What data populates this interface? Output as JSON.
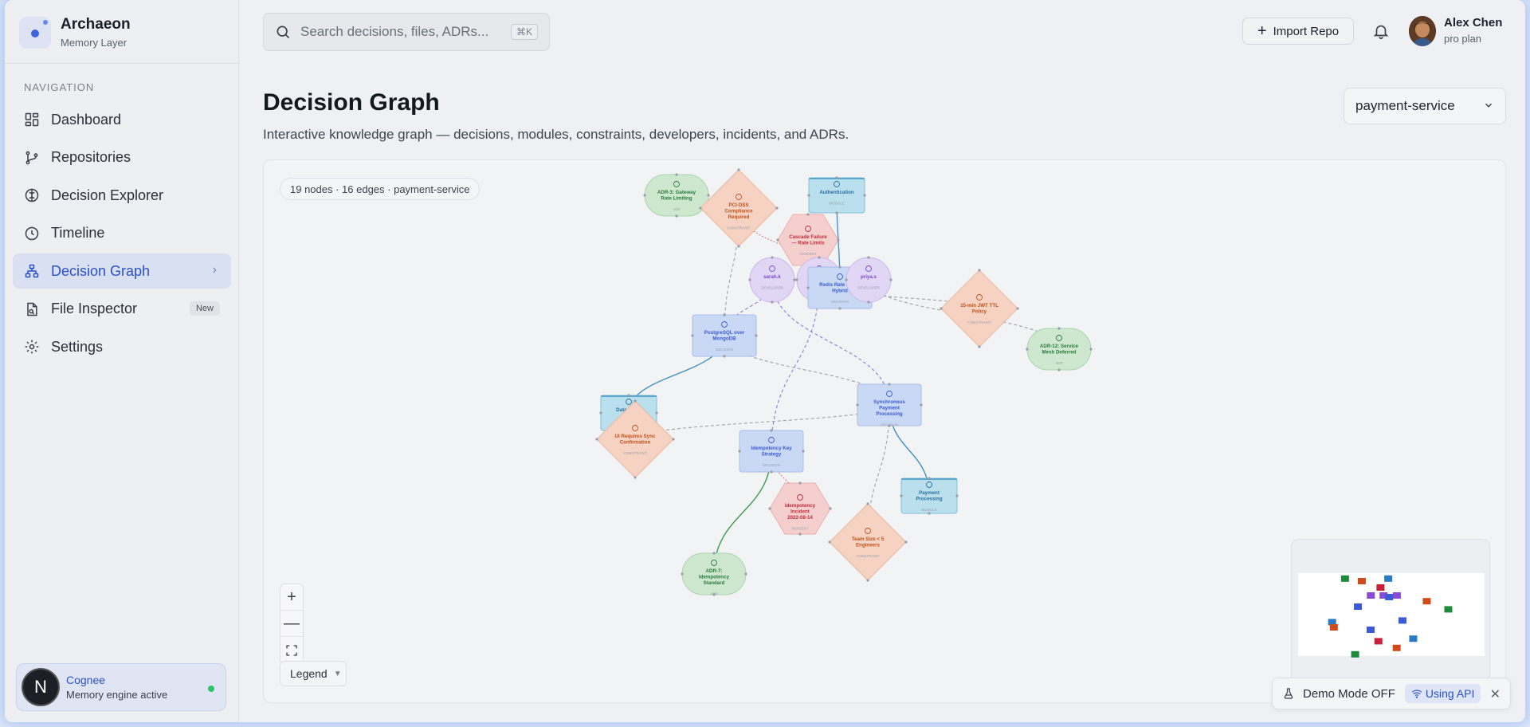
{
  "brand": {
    "name": "Archaeon",
    "subtitle": "Memory Layer"
  },
  "sidebar": {
    "heading": "NAVIGATION",
    "items": [
      {
        "label": "Dashboard",
        "icon": "grid-icon"
      },
      {
        "label": "Repositories",
        "icon": "git-branch-icon"
      },
      {
        "label": "Decision Explorer",
        "icon": "brain-icon"
      },
      {
        "label": "Timeline",
        "icon": "clock-icon"
      },
      {
        "label": "Decision Graph",
        "icon": "network-icon",
        "active": true
      },
      {
        "label": "File Inspector",
        "icon": "file-icon",
        "badge": "New"
      },
      {
        "label": "Settings",
        "icon": "gear-icon"
      }
    ],
    "engine": {
      "logo": "N",
      "name": "Cognee",
      "status": "Memory engine active"
    }
  },
  "header": {
    "search_placeholder": "Search decisions, files, ADRs...",
    "search_shortcut": "⌘K",
    "import_label": "Import Repo",
    "user": {
      "name": "Alex Chen",
      "plan": "pro plan"
    }
  },
  "page": {
    "title": "Decision Graph",
    "subtitle": "Interactive knowledge graph — decisions, modules, constraints, developers, incidents, and ADRs.",
    "repo_select": "payment-service"
  },
  "graph": {
    "stats": "19 nodes · 16 edges · payment-service",
    "legend_label": "Legend",
    "colors": {
      "decision": "#c9d8f5",
      "module": "#b9e0ec",
      "constraint": "#f6d2c3",
      "incident": "#f5cfcd",
      "developer": "#e1d6f4",
      "adr": "#cde8cf"
    },
    "nodes": [
      {
        "id": "adr3",
        "type": "adr",
        "shape": "pill",
        "title": "ADR-3: Gateway Rate Limiting",
        "kind": "ADR"
      },
      {
        "id": "pci",
        "type": "constraint",
        "shape": "diamond",
        "title": "PCI-DSS Compliance Required",
        "kind": "CONSTRAINT"
      },
      {
        "id": "auth",
        "type": "module",
        "shape": "rect",
        "title": "Authentication",
        "kind": "MODULE"
      },
      {
        "id": "cascade",
        "type": "incident",
        "shape": "hex",
        "title": "Cascade Failure — Rate Limits",
        "kind": "INCIDENT"
      },
      {
        "id": "sarah",
        "type": "developer",
        "shape": "circle",
        "title": "sarah.k",
        "kind": "DEVELOPER"
      },
      {
        "id": "marcus",
        "type": "developer",
        "shape": "circle",
        "title": "marcus",
        "kind": "DEVELOPER"
      },
      {
        "id": "redis",
        "type": "decision",
        "shape": "rect",
        "title": "Redis Rate Token Hybrid",
        "kind": "DECISION"
      },
      {
        "id": "priya",
        "type": "developer",
        "shape": "circle",
        "title": "priya.s",
        "kind": "DEVELOPER"
      },
      {
        "id": "jwt",
        "type": "constraint",
        "shape": "diamond",
        "title": "15-min JWT TTL Policy",
        "kind": "CONSTRAINT"
      },
      {
        "id": "postgres",
        "type": "decision",
        "shape": "rect",
        "title": "PostgreSQL over MongoDB",
        "kind": "DECISION"
      },
      {
        "id": "adr12",
        "type": "adr",
        "shape": "pill",
        "title": "ADR-12: Service Mesh Deferred",
        "kind": "ADR"
      },
      {
        "id": "datalayer",
        "type": "module",
        "shape": "rect",
        "title": "Data Layer",
        "kind": "MODULE"
      },
      {
        "id": "sync",
        "type": "decision",
        "shape": "rect",
        "title": "Synchronous Payment Processing",
        "kind": "DECISION"
      },
      {
        "id": "uisync",
        "type": "constraint",
        "shape": "diamond",
        "title": "UI Requires Sync Confirmation",
        "kind": "CONSTRAINT"
      },
      {
        "id": "idem",
        "type": "decision",
        "shape": "rect",
        "title": "Idempotency Key Strategy",
        "kind": "DECISION"
      },
      {
        "id": "payproc",
        "type": "module",
        "shape": "rect",
        "title": "Payment Processing",
        "kind": "MODULE"
      },
      {
        "id": "incident0814",
        "type": "incident",
        "shape": "hex",
        "title": "Idempotency Incident 2022-08-14",
        "kind": "INCIDENT"
      },
      {
        "id": "teamsize",
        "type": "constraint",
        "shape": "diamond",
        "title": "Team Size < 5 Engineers",
        "kind": "CONSTRAINT"
      },
      {
        "id": "adr7",
        "type": "adr",
        "shape": "pill",
        "title": "ADR-7: Idempotency Standard",
        "kind": "ADR"
      }
    ],
    "edges": [
      {
        "from": "auth",
        "to": "redis",
        "style": "solid",
        "color": "#4a90c8"
      },
      {
        "from": "postgres",
        "to": "datalayer",
        "style": "solid",
        "color": "#3f8fc0"
      },
      {
        "from": "sync",
        "to": "payproc",
        "style": "solid",
        "color": "#3f8fc0"
      },
      {
        "from": "idem",
        "to": "adr7",
        "style": "solid",
        "color": "#3a9a4a"
      },
      {
        "from": "sarah",
        "to": "postgres",
        "style": "dashed",
        "color": "#8f7ad8"
      },
      {
        "from": "sarah",
        "to": "sync",
        "style": "dashed",
        "color": "#8f7ad8"
      },
      {
        "from": "marcus",
        "to": "idem",
        "style": "dashed",
        "color": "#8f7ad8"
      },
      {
        "from": "adr3",
        "to": "pci",
        "style": "dotted",
        "color": "#d87a7a"
      },
      {
        "from": "pci",
        "to": "redis",
        "style": "dotted",
        "color": "#d87a7a"
      },
      {
        "from": "cascade",
        "to": "redis",
        "style": "dotted",
        "color": "#d87a7a"
      },
      {
        "from": "incident0814",
        "to": "idem",
        "style": "dotted",
        "color": "#d87a7a"
      },
      {
        "from": "pci",
        "to": "postgres",
        "style": "dashed",
        "color": "#a0a0a8"
      },
      {
        "from": "postgres",
        "to": "sync",
        "style": "dashed",
        "color": "#a0a0a8"
      },
      {
        "from": "uisync",
        "to": "sync",
        "style": "dashed",
        "color": "#a0a0a8"
      },
      {
        "from": "redis",
        "to": "jwt",
        "style": "dashed",
        "color": "#a0a0a8"
      },
      {
        "from": "priya",
        "to": "adr12",
        "style": "dashed",
        "color": "#a0a0a8"
      },
      {
        "from": "teamsize",
        "to": "sync",
        "style": "dashed",
        "color": "#a0a0a8"
      }
    ]
  },
  "minimap": {
    "nodes": [
      {
        "color": "#1f8a3a"
      },
      {
        "color": "#d04a1a"
      },
      {
        "color": "#2a7ac8"
      },
      {
        "color": "#c8203a"
      },
      {
        "color": "#8a4ad8"
      },
      {
        "color": "#8a4ad8"
      },
      {
        "color": "#3a5ad8"
      },
      {
        "color": "#8a4ad8"
      },
      {
        "color": "#d04a1a"
      },
      {
        "color": "#3a5ad8"
      },
      {
        "color": "#1f8a3a"
      },
      {
        "color": "#2a7ac8"
      },
      {
        "color": "#3a5ad8"
      },
      {
        "color": "#d04a1a"
      },
      {
        "color": "#3a5ad8"
      },
      {
        "color": "#2a7ac8"
      },
      {
        "color": "#c8203a"
      },
      {
        "color": "#d04a1a"
      },
      {
        "color": "#1f8a3a"
      }
    ]
  },
  "demo": {
    "label": "Demo Mode OFF",
    "api_label": "Using API"
  }
}
